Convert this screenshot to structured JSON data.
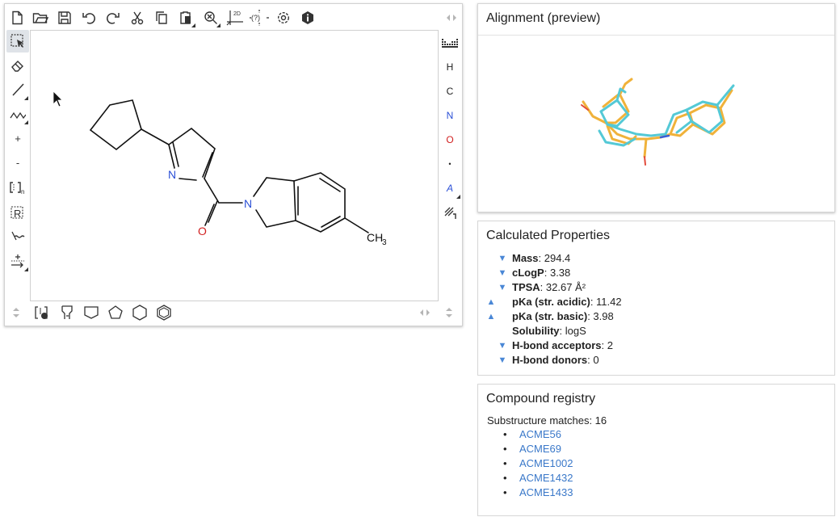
{
  "editor": {
    "top_toolbar": [
      "new-document-icon",
      "open-folder-icon",
      "save-icon",
      "undo-icon",
      "redo-icon",
      "cut-icon",
      "copy-icon",
      "paste-icon",
      "zoom-icon",
      "layout-2d-icon",
      "query-icon",
      "settings-icon",
      "info-icon"
    ],
    "layout_2d_label": "2D",
    "query_label": "(?)",
    "left_tools": {
      "plus": "+",
      "minus": "-",
      "bracket_sub": "n",
      "rgroup_letter": "R"
    },
    "right_atoms": {
      "h": "H",
      "c": "C",
      "n": "N",
      "o": "O",
      "dot": "•",
      "a": "A"
    },
    "right_colors": {
      "n": "#2a4fd6",
      "o": "#d11f1f",
      "a": "#2a4fd6"
    },
    "molecule": {
      "n_ring_label": "N",
      "n_amide_label": "N",
      "o_label": "O",
      "methyl_label": "CH",
      "methyl_sub": "3"
    }
  },
  "alignment": {
    "title": "Alignment (preview)"
  },
  "properties": {
    "title": "Calculated Properties",
    "items": [
      {
        "arrow": "down",
        "name": "Mass",
        "value": ": 294.4"
      },
      {
        "arrow": "down",
        "name": "cLogP",
        "value": ": 3.38"
      },
      {
        "arrow": "down",
        "name": "TPSA",
        "value": ": 32.67 Å²"
      },
      {
        "arrow": "up",
        "name": "pKa (str. acidic)",
        "value": ": 11.42"
      },
      {
        "arrow": "up",
        "name": "pKa (str. basic)",
        "value": ": 3.98"
      },
      {
        "arrow": "none",
        "name": "Solubility",
        "value": ": logS"
      },
      {
        "arrow": "down",
        "name": "H-bond acceptors",
        "value": ": 2"
      },
      {
        "arrow": "down",
        "name": "H-bond donors",
        "value": ": 0"
      }
    ],
    "arrow_color": "#4a87d6"
  },
  "registry": {
    "title": "Compound registry",
    "subtitle": "Substructure matches: 16",
    "items": [
      "ACME56",
      "ACME69",
      "ACME1002",
      "ACME1432",
      "ACME1433"
    ],
    "link_color": "#3a78c9"
  }
}
